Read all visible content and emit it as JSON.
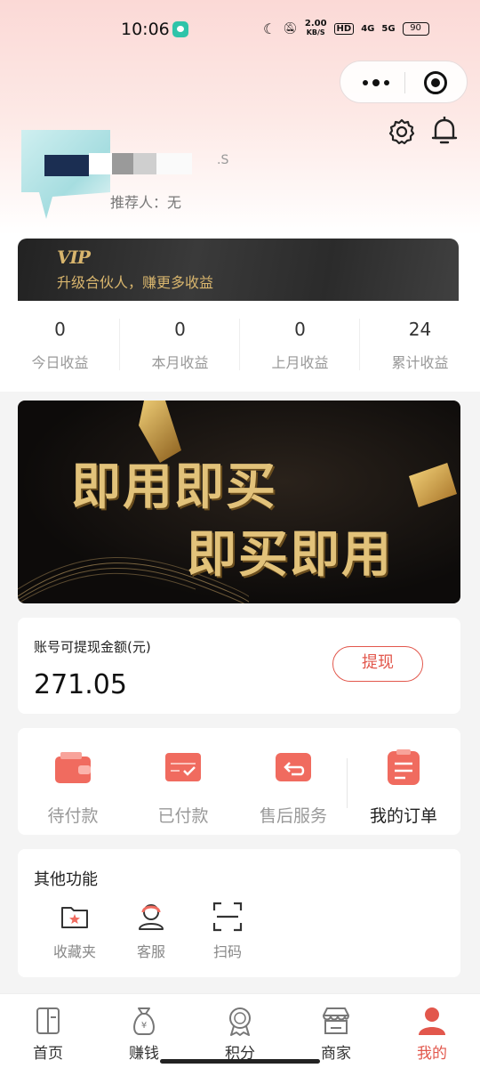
{
  "status_bar": {
    "time": "10:06",
    "speed": "2.00",
    "speed_unit": "KB/S",
    "hd": "HD",
    "net1": "4G",
    "net2": "5G",
    "battery": "90"
  },
  "profile": {
    "nickname_suffix": ".S",
    "referrer": "推荐人：无"
  },
  "vip": {
    "logo": "VIP",
    "text": "升级合伙人，赚更多收益"
  },
  "stats": [
    {
      "value": "0",
      "label": "今日收益"
    },
    {
      "value": "0",
      "label": "本月收益"
    },
    {
      "value": "0",
      "label": "上月收益"
    },
    {
      "value": "24",
      "label": "累计收益"
    }
  ],
  "banner": {
    "line1": "即用即买",
    "line2": "即买即用"
  },
  "withdraw": {
    "label": "账号可提现金额(元)",
    "amount": "271.05",
    "button": "提现"
  },
  "orders": [
    {
      "label": "待付款",
      "icon": "wallet-icon"
    },
    {
      "label": "已付款",
      "icon": "card-check-icon"
    },
    {
      "label": "售后服务",
      "icon": "return-icon"
    },
    {
      "label": "我的订单",
      "icon": "order-list-icon"
    }
  ],
  "others": {
    "title": "其他功能",
    "items": [
      {
        "label": "收藏夹",
        "icon": "favorites-folder-icon"
      },
      {
        "label": "客服",
        "icon": "customer-service-icon"
      },
      {
        "label": "扫码",
        "icon": "scan-icon"
      }
    ]
  },
  "tabbar": [
    {
      "label": "首页",
      "icon": "home-icon"
    },
    {
      "label": "赚钱",
      "icon": "money-bag-icon"
    },
    {
      "label": "积分",
      "icon": "medal-icon"
    },
    {
      "label": "商家",
      "icon": "store-icon"
    },
    {
      "label": "我的",
      "icon": "user-icon",
      "active": true
    }
  ],
  "colors": {
    "accent": "#e2574c",
    "gold": "#d8b56d"
  }
}
